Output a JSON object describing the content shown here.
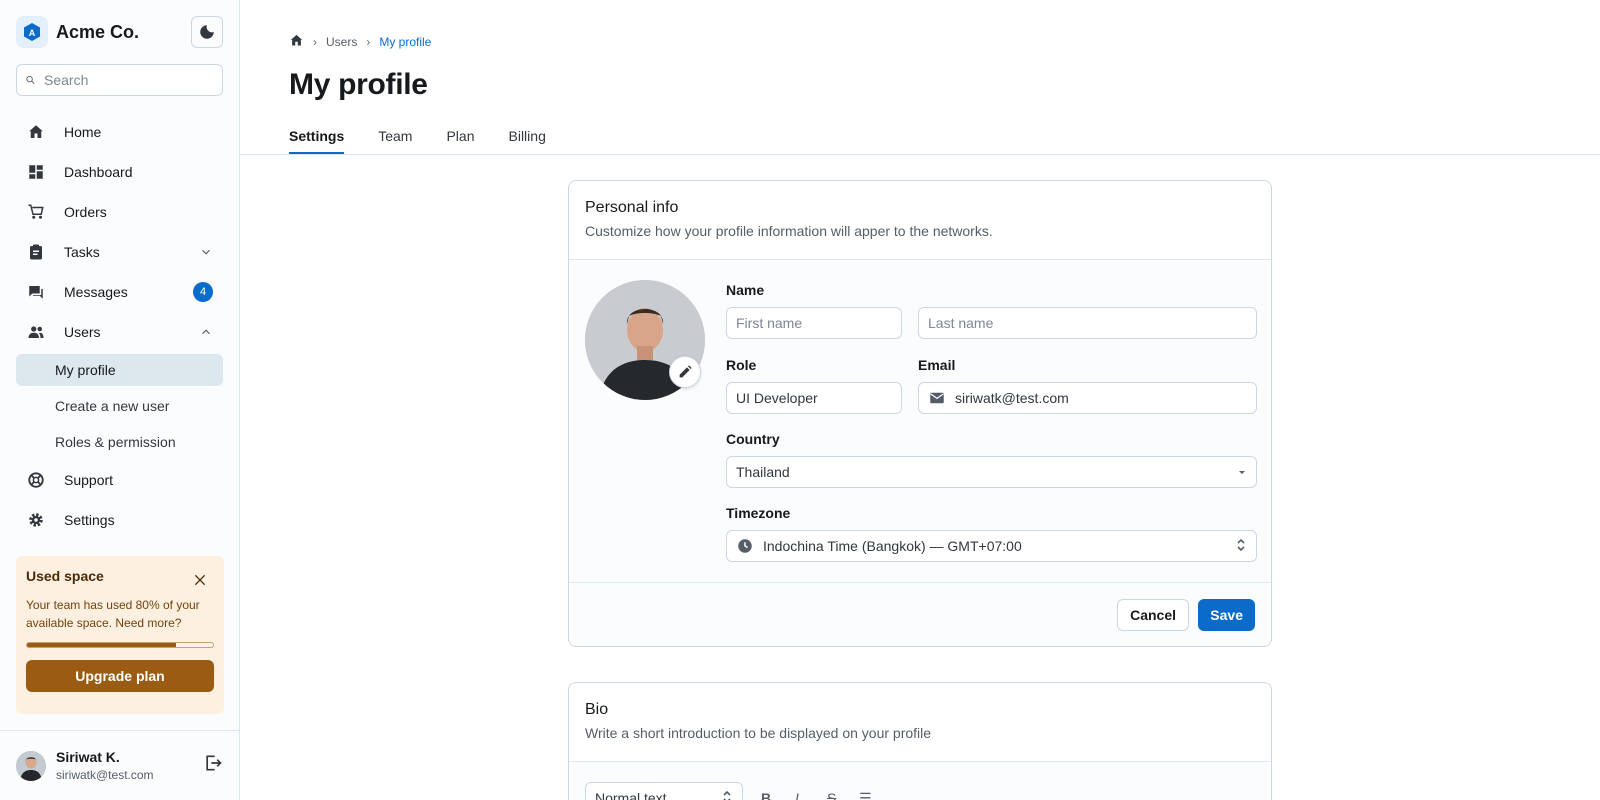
{
  "brand": {
    "name": "Acme Co."
  },
  "search": {
    "placeholder": "Search"
  },
  "nav": {
    "home": "Home",
    "dashboard": "Dashboard",
    "orders": "Orders",
    "tasks": "Tasks",
    "messages": "Messages",
    "messages_badge": "4",
    "users": "Users",
    "users_sub": [
      "My profile",
      "Create a new user",
      "Roles & permission"
    ],
    "support": "Support",
    "settings": "Settings"
  },
  "used_space": {
    "title": "Used space",
    "text": "Your team has used 80% of your available space. Need more?",
    "progress_percent": 80,
    "button": "Upgrade plan"
  },
  "user": {
    "name": "Siriwat K.",
    "email": "siriwatk@test.com"
  },
  "breadcrumb": {
    "parent": "Users",
    "current": "My profile"
  },
  "page": {
    "title": "My profile"
  },
  "tabs": [
    "Settings",
    "Team",
    "Plan",
    "Billing"
  ],
  "personal_info": {
    "title": "Personal info",
    "subtitle": "Customize how your profile information will apper to the networks.",
    "name_label": "Name",
    "first_name_placeholder": "First name",
    "last_name_placeholder": "Last name",
    "role_label": "Role",
    "role_value": "UI Developer",
    "email_label": "Email",
    "email_value": "siriwatk@test.com",
    "country_label": "Country",
    "country_value": "Thailand",
    "timezone_label": "Timezone",
    "timezone_value": "Indochina Time (Bangkok) — GMT+07:00",
    "cancel": "Cancel",
    "save": "Save"
  },
  "bio": {
    "title": "Bio",
    "subtitle": "Write a short introduction to be displayed on your profile",
    "text_style": "Normal text"
  },
  "colors": {
    "primary": "#0b6bcb",
    "warning_bg": "#fdf0e1",
    "warning_solid": "#9a5b13"
  }
}
